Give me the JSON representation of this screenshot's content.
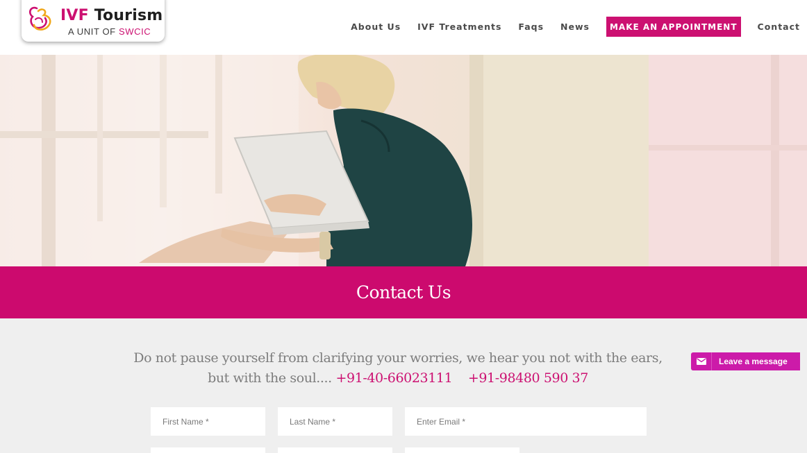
{
  "brand": {
    "title_prefix": "IVF",
    "title_rest": " Tourism",
    "subtitle_prefix": "A UNIT OF ",
    "subtitle_highlight": "SWCIC",
    "accent_color": "#cc1071"
  },
  "nav": {
    "items": [
      {
        "label": "About Us"
      },
      {
        "label": "IVF Treatments"
      },
      {
        "label": "Faqs"
      },
      {
        "label": "News"
      },
      {
        "label": "MAKE AN APPOINTMENT"
      },
      {
        "label": "Contact"
      }
    ]
  },
  "page": {
    "title": "Contact Us"
  },
  "intro": {
    "line1": "Do not pause yourself from clarifying your worries, we hear you not with the ears,",
    "line2": "but with the soul.... ",
    "phone1": "+91-40-66023111",
    "phone2": "+91-98480 590 37"
  },
  "form": {
    "first_name_placeholder": "First Name *",
    "last_name_placeholder": "Last Name *",
    "email_placeholder": "Enter Email *"
  },
  "chat": {
    "label": "Leave a message",
    "icon": "envelope-icon"
  }
}
